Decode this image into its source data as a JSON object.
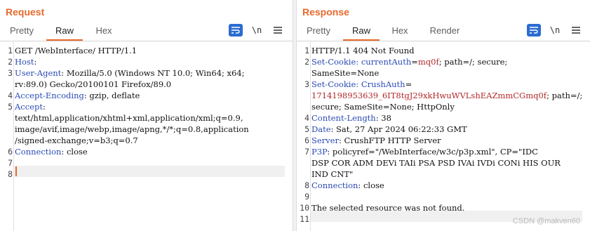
{
  "request": {
    "title": "Request",
    "tabs": [
      "Pretty",
      "Raw",
      "Hex"
    ],
    "active_tab": "Raw",
    "newline_label": "\\n"
  },
  "response": {
    "title": "Response",
    "tabs": [
      "Pretty",
      "Raw",
      "Hex",
      "Render"
    ],
    "active_tab": "Raw",
    "newline_label": "\\n"
  },
  "request_lines": [
    {
      "n": "1",
      "name": "",
      "value": "GET /WebInterface/ HTTP/1.1"
    },
    {
      "n": "2",
      "name": "Host",
      "value": ":"
    },
    {
      "n": "3",
      "name": "User-Agent",
      "value": ": Mozilla/5.0 (Windows NT 10.0; Win64; x64;"
    },
    {
      "n": "",
      "name": "",
      "value": "rv:89.0) Gecko/20100101 Firefox/89.0"
    },
    {
      "n": "4",
      "name": "Accept-Encoding",
      "value": ": gzip, deflate"
    },
    {
      "n": "5",
      "name": "Accept",
      "value": ":"
    },
    {
      "n": "",
      "name": "",
      "value": "text/html,application/xhtml+xml,application/xml;q=0.9,"
    },
    {
      "n": "",
      "name": "",
      "value": "image/avif,image/webp,image/apng,*/*;q=0.8,application"
    },
    {
      "n": "",
      "name": "",
      "value": "/signed-exchange;v=b3;q=0.7"
    },
    {
      "n": "6",
      "name": "Connection",
      "value": ": close"
    },
    {
      "n": "7",
      "name": "",
      "value": ""
    },
    {
      "n": "8",
      "name": "",
      "value": ""
    }
  ],
  "response_lines": [
    {
      "n": "1",
      "name": "",
      "cname": "",
      "cval": "",
      "value": "HTTP/1.1 404 Not Found"
    },
    {
      "n": "2",
      "name": "Set-Cookie",
      "cname": ": currentAuth",
      "cval": "mq0f",
      "value": "; path=/; secure;"
    },
    {
      "n": "",
      "name": "",
      "cname": "",
      "cval": "",
      "value": "SameSite=None"
    },
    {
      "n": "3",
      "name": "Set-Cookie",
      "cname": ": CrushAuth",
      "cval": "",
      "value": ""
    },
    {
      "n": "",
      "name": "",
      "cname": "",
      "cval": "1714198953639_6IT8tgJ29xkHwuWVLshEAZmmCGmq0f",
      "value": "; path=/;"
    },
    {
      "n": "",
      "name": "",
      "cname": "",
      "cval": "",
      "value": "secure; SameSite=None; HttpOnly"
    },
    {
      "n": "4",
      "name": "Content-Length",
      "cname": "",
      "cval": "",
      "value": ": 38"
    },
    {
      "n": "5",
      "name": "Date",
      "cname": "",
      "cval": "",
      "value": ": Sat, 27 Apr 2024 06:22:33 GMT"
    },
    {
      "n": "6",
      "name": "Server",
      "cname": "",
      "cval": "",
      "value": ": CrushFTP HTTP Server"
    },
    {
      "n": "7",
      "name": "P3P",
      "cname": "",
      "cval": "",
      "value": ": policyref=\"/WebInterface/w3c/p3p.xml\", CP=\"IDC"
    },
    {
      "n": "",
      "name": "",
      "cname": "",
      "cval": "",
      "value": "DSP COR ADM DEVi TAIi PSA PSD IVAi IVDi CONi HIS OUR"
    },
    {
      "n": "",
      "name": "",
      "cname": "",
      "cval": "",
      "value": "IND CNT\""
    },
    {
      "n": "8",
      "name": "Connection",
      "cname": "",
      "cval": "",
      "value": ": close"
    },
    {
      "n": "9",
      "name": "",
      "cname": "",
      "cval": "",
      "value": ""
    },
    {
      "n": "10",
      "name": "",
      "cname": "",
      "cval": "",
      "value": "The selected resource was not found."
    },
    {
      "n": "11",
      "name": "",
      "cname": "",
      "cval": "",
      "value": ""
    }
  ],
  "watermark": "CSDN @makven60",
  "colors": {
    "accent": "#e8692c",
    "header_name": "#2a4ab5",
    "cookie_value": "#b3282a",
    "button_blue": "#2b6cd1"
  }
}
